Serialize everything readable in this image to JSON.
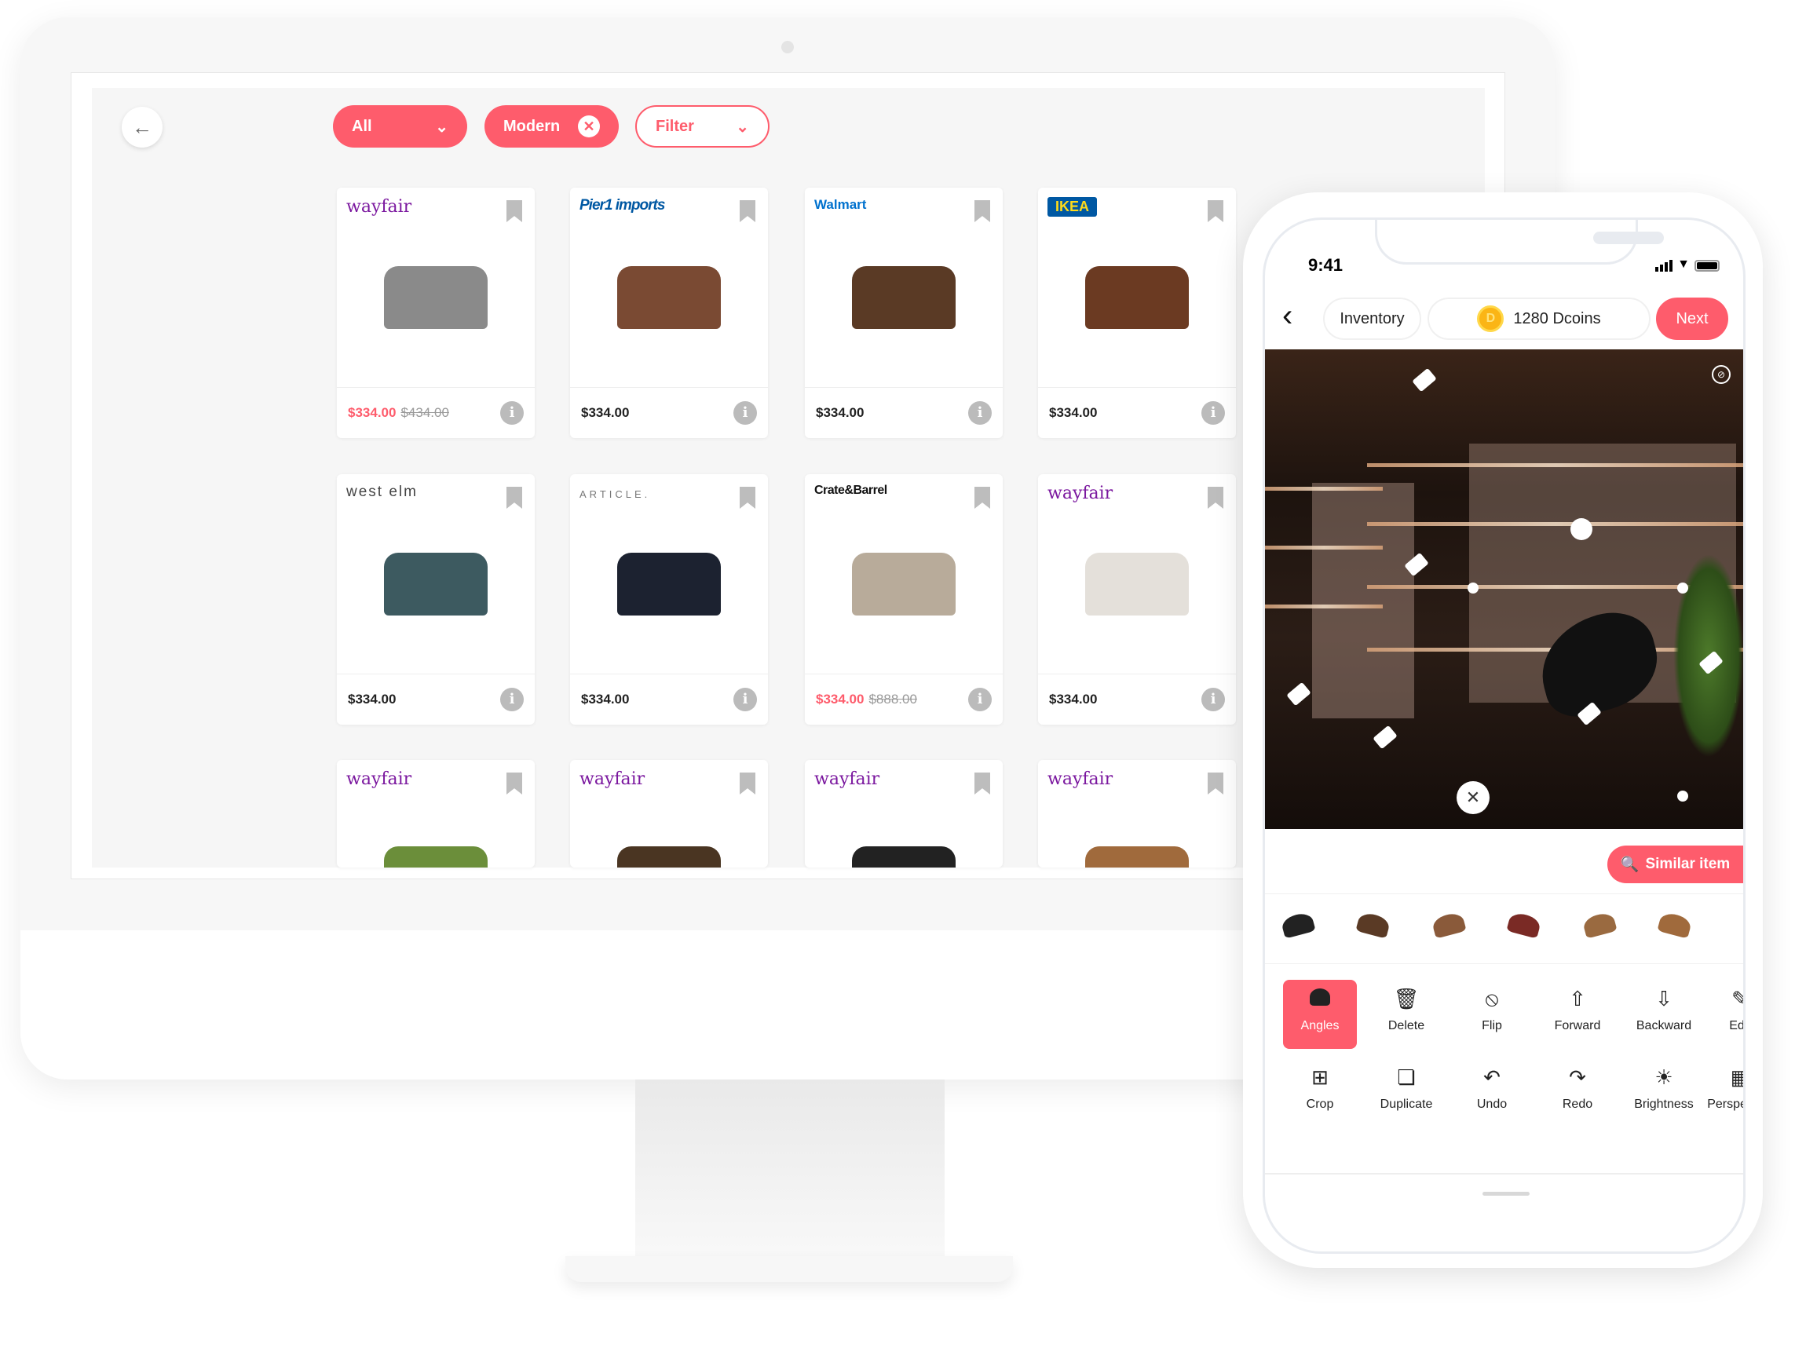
{
  "desktop": {
    "filters": {
      "all_label": "All",
      "modern_label": "Modern",
      "filter_label": "Filter"
    },
    "products": [
      {
        "brand": "wayfair",
        "price": "$334.00",
        "old_price": "$434.00",
        "sale": true
      },
      {
        "brand": "Pier1 imports",
        "price": "$334.00",
        "sale": false
      },
      {
        "brand": "Walmart",
        "price": "$334.00",
        "sale": false
      },
      {
        "brand": "IKEA",
        "price": "$334.00",
        "sale": false
      },
      {
        "brand": "west elm",
        "price": "$334.00",
        "sale": false
      },
      {
        "brand": "ARTICLE.",
        "price": "$334.00",
        "sale": false
      },
      {
        "brand": "Crate&Barrel",
        "price": "$334.00",
        "old_price": "$888.00",
        "sale": true
      },
      {
        "brand": "wayfair",
        "price": "$334.00",
        "sale": false
      },
      {
        "brand": "wayfair",
        "price": "",
        "sale": false
      },
      {
        "brand": "wayfair",
        "price": "",
        "sale": false
      },
      {
        "brand": "wayfair",
        "price": "",
        "sale": false
      },
      {
        "brand": "wayfair",
        "price": "",
        "sale": false
      }
    ]
  },
  "phone": {
    "time": "9:41",
    "inventory_label": "Inventory",
    "coins": "1280 Dcoins",
    "coin_symbol": "D",
    "next_label": "Next",
    "similar_label": "Similar item",
    "tools_row1": [
      {
        "label": "Angles",
        "icon": "chair-icon",
        "active": true
      },
      {
        "label": "Delete",
        "icon": "trash-icon"
      },
      {
        "label": "Flip",
        "icon": "flip-icon"
      },
      {
        "label": "Forward",
        "icon": "arrow-up-icon"
      },
      {
        "label": "Backward",
        "icon": "arrow-down-icon"
      },
      {
        "label": "Edit",
        "icon": "edit-icon"
      }
    ],
    "tools_row2": [
      {
        "label": "Crop",
        "icon": "crop-icon"
      },
      {
        "label": "Duplicate",
        "icon": "duplicate-icon"
      },
      {
        "label": "Undo",
        "icon": "undo-icon"
      },
      {
        "label": "Redo",
        "icon": "redo-icon"
      },
      {
        "label": "Brightness",
        "icon": "brightness-icon"
      },
      {
        "label": "Perspective",
        "icon": "perspective-icon"
      }
    ]
  },
  "colors": {
    "accent": "#fe5c6c",
    "wayfair": "#7b189f",
    "walmart": "#0071ce",
    "ikea_blue": "#0058a3",
    "ikea_yellow": "#ffda1a"
  }
}
